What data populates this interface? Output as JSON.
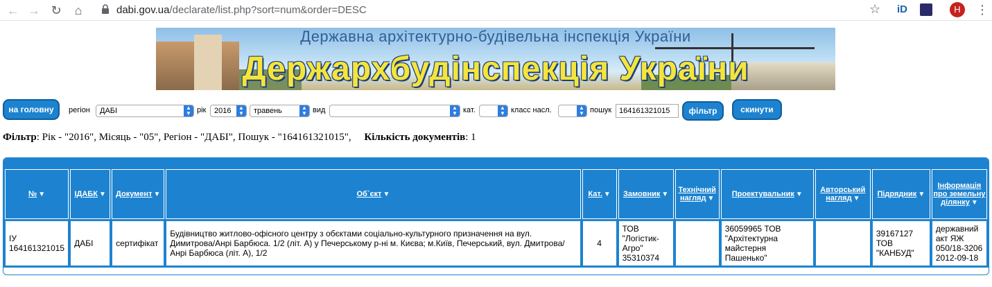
{
  "browser": {
    "url_host": "dabi.gov.ua",
    "url_path": "/declarate/list.php?sort=num&order=DESC",
    "avatar_letter": "H",
    "ext_label": "iD"
  },
  "banner": {
    "subtitle": "Державна архітектурно-будівельна інспекція України",
    "title": "Держархбудінспекція України"
  },
  "form": {
    "home_button": "на головну",
    "region_label": "регіон",
    "region_value": "ДАБІ",
    "year_label": "рік",
    "year_value": "2016",
    "month_value": "травень",
    "type_label": "вид",
    "type_value": "",
    "cat_label": "кат.",
    "cat_value": "",
    "class_label": "класс насл.",
    "class_value": "",
    "search_label": "пошук",
    "search_value": "164161321015",
    "filter_button": "фільтр",
    "reset_button": "скинути"
  },
  "filter_summary": {
    "label": "Фільтр",
    "text": ": Рік - \"2016\", Місяць - \"05\", Регіон - \"ДАБІ\", Пошук - \"164161321015\",",
    "count_label": "Кількість документів",
    "count_value": ": 1"
  },
  "table": {
    "headers": [
      "№",
      "ІДАБК",
      "Документ",
      "Об`єкт",
      "Кат.",
      "Замовник",
      "Технічний нагляд",
      "Проектувальник",
      "Авторський нагляд",
      "Підрядник",
      "Інформація про земельну ділянку"
    ],
    "rows": [
      {
        "num": "ІУ 164161321015",
        "idabk": "ДАБІ",
        "document": "сертифікат",
        "object": "Будівництво житлово-офісного центру з обєктами соціально-культурного призначення на вул. Димитрова/Анрі Барбюса. 1/2 (літ. А) у Печерському р-ні м. Києва; м.Київ, Печерський, вул. Дмитрова/ Анрі Барбюса (літ. А), 1/2",
        "cat": "4",
        "customer": "ТОВ \"Логістик-Агро\" 35310374",
        "tech_supervision": "",
        "designer": "36059965 ТОВ \"Архітектурна майстерня Пашенько\"",
        "author_supervision": "",
        "contractor": "39167127 ТОВ \"КАНБУД\"",
        "land_info": "державний акт ЯЖ 050/18-3206 2012-09-18"
      }
    ]
  }
}
